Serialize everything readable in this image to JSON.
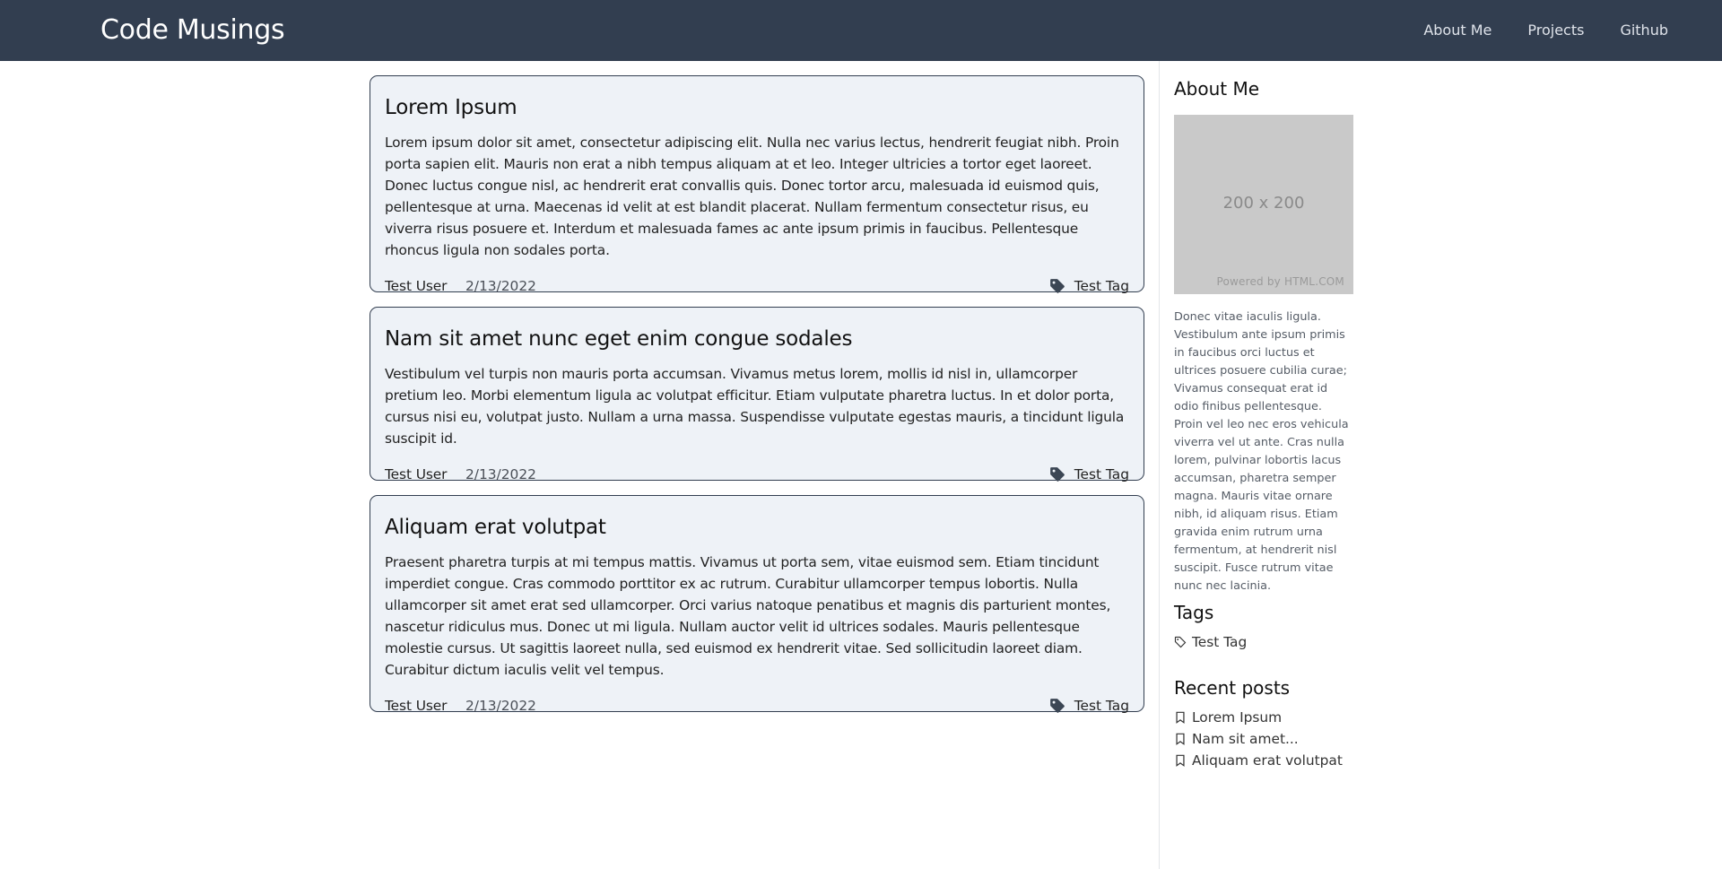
{
  "nav": {
    "brand": "Code Musings",
    "links": [
      "About Me",
      "Projects",
      "Github"
    ]
  },
  "posts": [
    {
      "title": "Lorem Ipsum",
      "body": "Lorem ipsum dolor sit amet, consectetur adipiscing elit. Nulla nec varius lectus, hendrerit feugiat nibh. Proin porta sapien elit. Mauris non erat a nibh tempus aliquam at et leo. Integer ultricies a tortor eget laoreet. Donec luctus congue nisl, ac hendrerit erat convallis quis. Donec tortor arcu, malesuada id euismod quis, pellentesque at urna. Maecenas id velit at est blandit placerat. Nullam fermentum consectetur risus, eu viverra risus posuere et. Interdum et malesuada fames ac ante ipsum primis in faucibus. Pellentesque rhoncus ligula non sodales porta.",
      "author": "Test User",
      "date": "2/13/2022",
      "tag": "Test Tag"
    },
    {
      "title": "Nam sit amet nunc eget enim congue sodales",
      "body": "Vestibulum vel turpis non mauris porta accumsan. Vivamus metus lorem, mollis id nisl in, ullamcorper pretium leo. Morbi elementum ligula ac volutpat efficitur. Etiam vulputate pharetra luctus. In et dolor porta, cursus nisi eu, volutpat justo. Nullam a urna massa. Suspendisse vulputate egestas mauris, a tincidunt ligula suscipit id.",
      "author": "Test User",
      "date": "2/13/2022",
      "tag": "Test Tag"
    },
    {
      "title": "Aliquam erat volutpat",
      "body": "Praesent pharetra turpis at mi tempus mattis. Vivamus ut porta sem, vitae euismod sem. Etiam tincidunt imperdiet congue. Cras commodo porttitor ex ac rutrum. Curabitur ullamcorper tempus lobortis. Nulla ullamcorper sit amet erat sed ullamcorper. Orci varius natoque penatibus et magnis dis parturient montes, nascetur ridiculus mus. Donec ut mi ligula. Nullam auctor velit id ultrices sodales. Mauris pellentesque molestie cursus. Ut sagittis laoreet nulla, sed euismod ex hendrerit vitae. Sed sollicitudin laoreet diam. Curabitur dictum iaculis velit vel tempus.",
      "author": "Test User",
      "date": "2/13/2022",
      "tag": "Test Tag"
    }
  ],
  "sidebar": {
    "about_heading": "About Me",
    "placeholder_dims": "200 x 200",
    "placeholder_credit": "Powered by HTML.COM",
    "about_text": "Donec vitae iaculis ligula. Vestibulum ante ipsum primis in faucibus orci luctus et ultrices posuere cubilia curae; Vivamus consequat erat id odio finibus pellentesque. Proin vel leo nec eros vehicula viverra vel ut ante. Cras nulla lorem, pulvinar lobortis lacus accumsan, pharetra semper magna. Mauris vitae ornare nibh, id aliquam risus. Etiam gravida enim rutrum urna fermentum, at hendrerit nisl suscipit. Fusce rutrum vitae nunc nec lacinia.",
    "tags_heading": "Tags",
    "tags": [
      "Test Tag"
    ],
    "recent_heading": "Recent posts",
    "recent": [
      "Lorem Ipsum",
      "Nam sit amet...",
      "Aliquam erat volutpat"
    ]
  },
  "colors": {
    "navbar": "#323e50",
    "card_bg": "#eef2f7",
    "card_border": "#323e50"
  },
  "icons": {
    "post_tag": "tag-icon",
    "sidebar_tag": "tag-outline-icon",
    "recent_post": "bookmark-icon"
  }
}
